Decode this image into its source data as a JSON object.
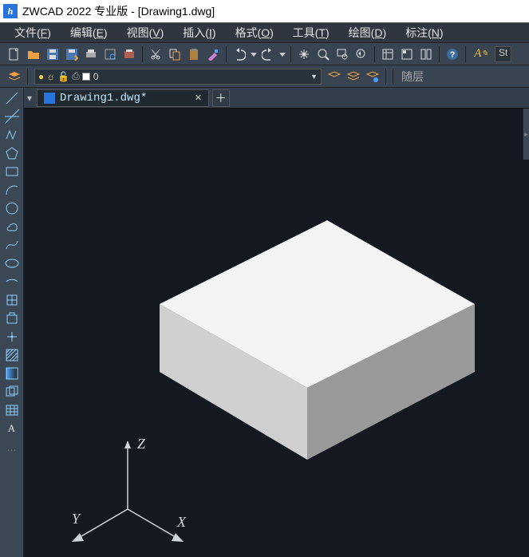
{
  "titlebar": {
    "title": "ZWCAD 2022 专业版 - [Drawing1.dwg]"
  },
  "menubar": {
    "items": [
      {
        "label": "文件",
        "key": "F"
      },
      {
        "label": "编辑",
        "key": "E"
      },
      {
        "label": "视图",
        "key": "V"
      },
      {
        "label": "插入",
        "key": "I"
      },
      {
        "label": "格式",
        "key": "O"
      },
      {
        "label": "工具",
        "key": "T"
      },
      {
        "label": "绘图",
        "key": "D"
      },
      {
        "label": "标注",
        "key": "N"
      }
    ]
  },
  "toolbar1": {
    "buttons": [
      "new-doc",
      "open",
      "save",
      "save-as",
      "plot",
      "plot-preview",
      "publish",
      "sep",
      "cut",
      "copy",
      "paste",
      "match-prop",
      "sep",
      "undo",
      "undo-dd",
      "redo",
      "redo-dd",
      "sep",
      "pan",
      "zoom-realtime",
      "zoom-window",
      "zoom-prev",
      "sep",
      "properties",
      "design-center",
      "tool-palettes",
      "sep",
      "help"
    ]
  },
  "stylebox": {
    "label": "St"
  },
  "layerbar": {
    "layer_name": "0",
    "right_label": "随层"
  },
  "tabs": {
    "active": "Drawing1.dwg*"
  },
  "left_tools": [
    "line",
    "construction-line",
    "polyline",
    "polygon",
    "rectangle",
    "arc",
    "circle",
    "revision-cloud",
    "spline",
    "ellipse",
    "ellipse-arc",
    "insert-block",
    "make-block",
    "point",
    "hatch",
    "gradient",
    "region",
    "table",
    "mtext"
  ],
  "viewport": {
    "axes": [
      "X",
      "Y",
      "Z"
    ]
  }
}
